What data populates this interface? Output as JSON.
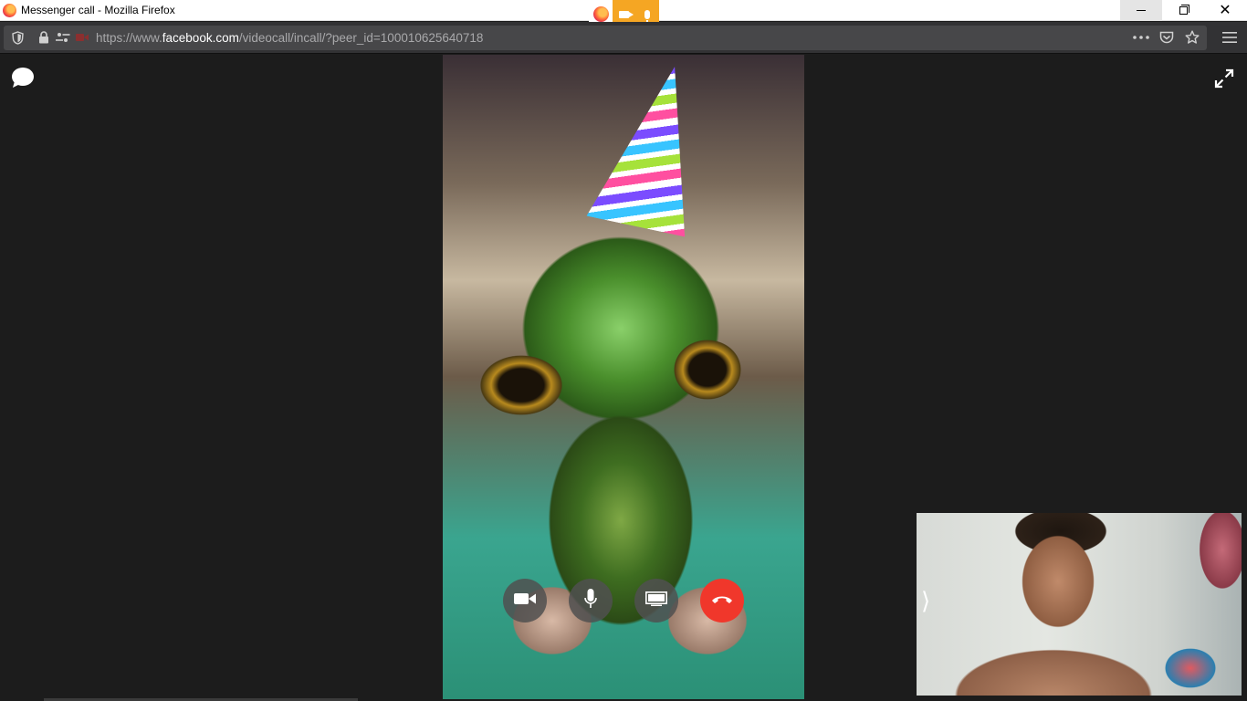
{
  "window": {
    "title": "Messenger call - Mozilla Firefox",
    "close_glyph": "✕"
  },
  "sharing_indicator": {
    "items": [
      "firefox-icon",
      "camera-icon",
      "microphone-icon"
    ],
    "color": "#f5a623"
  },
  "urlbar": {
    "prefix": "https://www.",
    "domain": "facebook.com",
    "path": "/videocall/incall/?peer_id=100010625640718"
  },
  "call": {
    "controls": [
      "video-camera-icon",
      "microphone-icon",
      "screen-share-icon",
      "hang-up-icon"
    ],
    "end_call_color": "#f0372b",
    "self_view_chevron": "⟩"
  },
  "colors": {
    "background": "#1c1c1c",
    "toolbar": "#323234",
    "urlbar": "#474749"
  }
}
